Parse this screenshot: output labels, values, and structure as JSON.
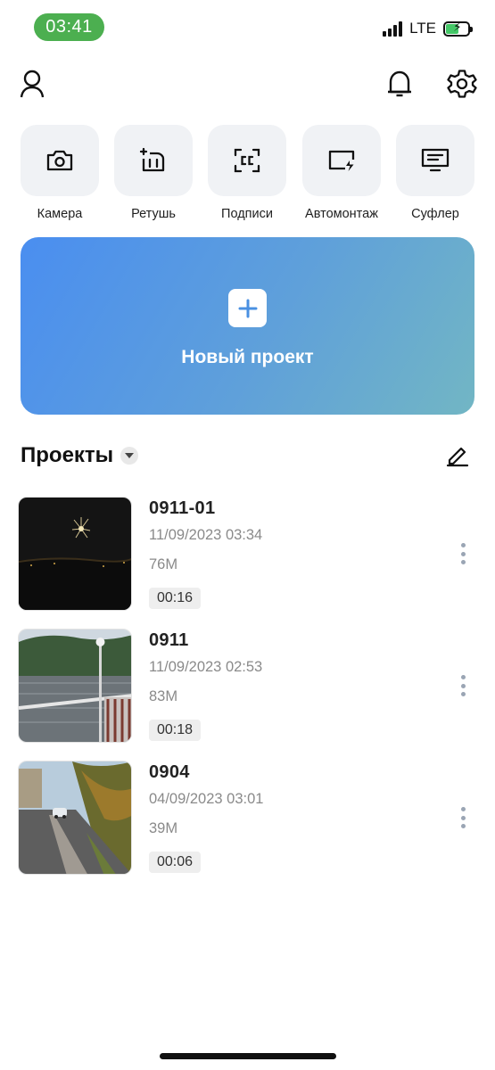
{
  "status": {
    "time": "03:41",
    "network": "LTE",
    "time_pill_color": "#4caf50"
  },
  "header": {
    "profile_icon": "user-icon",
    "notifications_icon": "bell-icon",
    "settings_icon": "gear-icon"
  },
  "tools": [
    {
      "label": "Камера",
      "icon": "camera-icon"
    },
    {
      "label": "Ретушь",
      "icon": "retouch-icon"
    },
    {
      "label": "Подписи",
      "icon": "captions-icon"
    },
    {
      "label": "Автомонтаж",
      "icon": "auto-edit-icon"
    },
    {
      "label": "Суфлер",
      "icon": "teleprompter-icon"
    }
  ],
  "new_project": {
    "label": "Новый проект",
    "gradient_start": "#4a8ef0",
    "gradient_end": "#72b6c4"
  },
  "projects": {
    "title": "Проекты",
    "items": [
      {
        "name": "0911-01",
        "date": "11/09/2023 03:34",
        "size": "76M",
        "duration": "00:16"
      },
      {
        "name": "0911",
        "date": "11/09/2023 02:53",
        "size": "83M",
        "duration": "00:18"
      },
      {
        "name": "0904",
        "date": "04/09/2023 03:01",
        "size": "39M",
        "duration": "00:06"
      }
    ]
  }
}
